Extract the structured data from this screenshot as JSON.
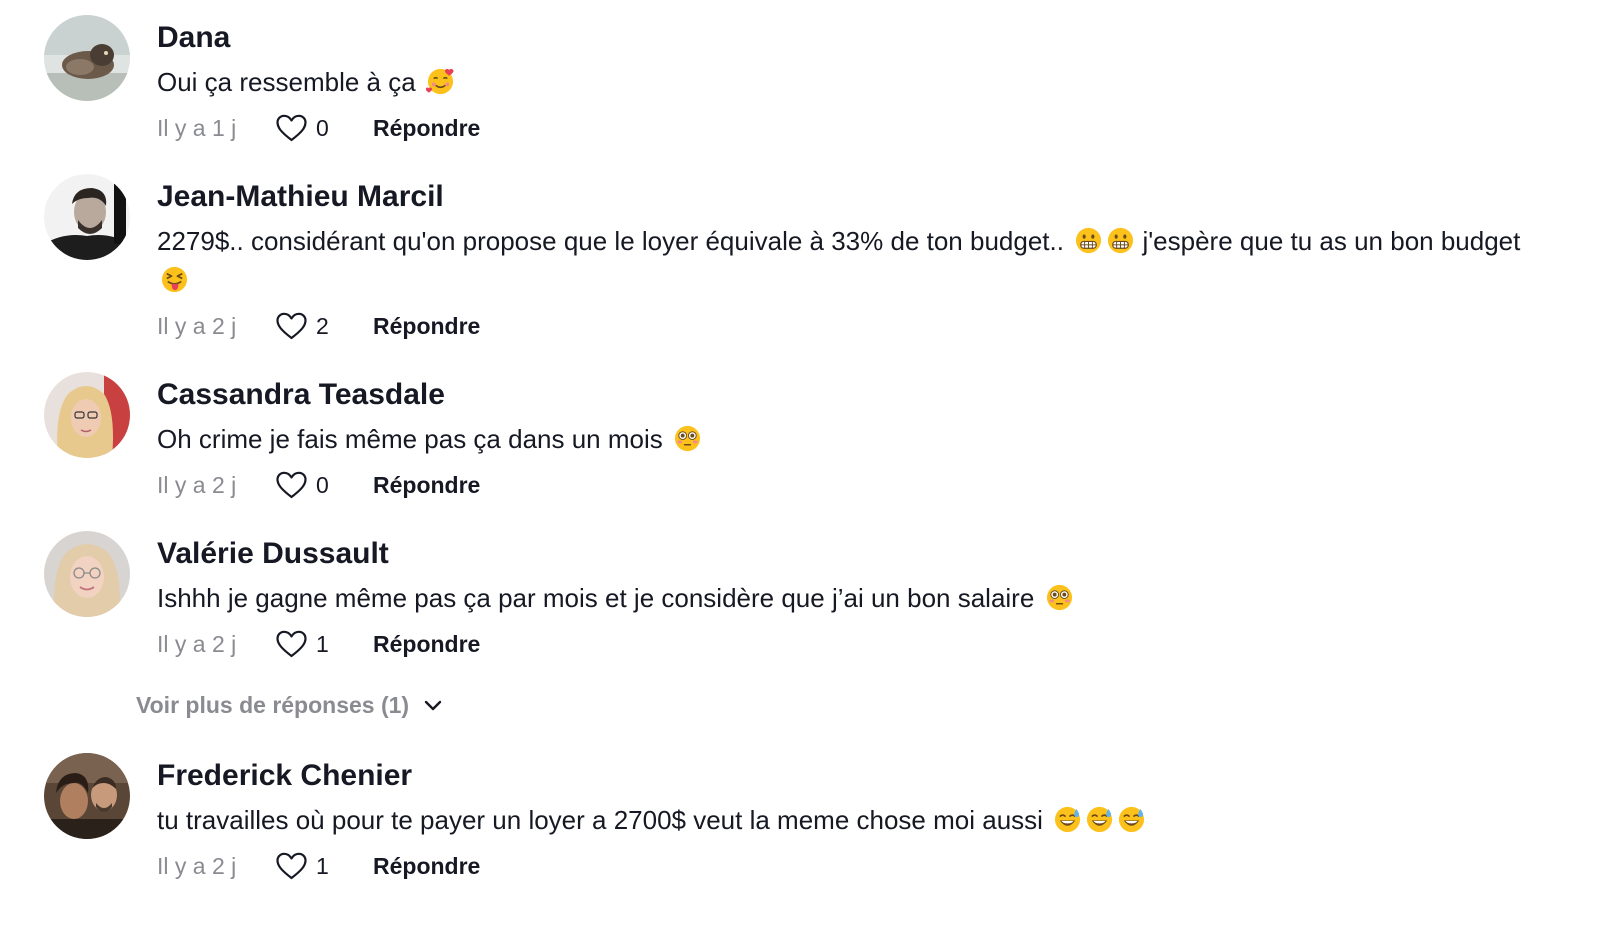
{
  "comments": [
    {
      "author": "Dana",
      "text": "Oui ça ressemble à ça",
      "emojis": [
        "smiling-face-with-hearts"
      ],
      "time": "Il y a 1 j",
      "likes": "0",
      "reply_label": "Répondre"
    },
    {
      "author": "Jean-Mathieu Marcil",
      "text": "2279$.. considérant qu'on propose que le loyer équivale à 33% de ton budget..",
      "text_emojis_mid": [
        "grimacing-face",
        "grimacing-face"
      ],
      "text_after": "j'espère que tu as un bon budget",
      "emojis": [
        "squinting-tongue-face"
      ],
      "time": "Il y a 2 j",
      "likes": "2",
      "reply_label": "Répondre"
    },
    {
      "author": "Cassandra Teasdale",
      "text": "Oh crime je fais même pas ça dans un mois",
      "emojis": [
        "flushed-face"
      ],
      "time": "Il y a 2 j",
      "likes": "0",
      "reply_label": "Répondre"
    },
    {
      "author": "Valérie Dussault",
      "text": "Ishhh je gagne même pas ça par mois et je considère que j’ai un bon salaire",
      "emojis": [
        "flushed-face"
      ],
      "time": "Il y a 2 j",
      "likes": "1",
      "reply_label": "Répondre"
    },
    {
      "author": "Frederick Chenier",
      "text": "tu travailles où pour te payer un loyer a 2700$ veut la meme chose moi aussi",
      "emojis": [
        "sweat-smile-face",
        "sweat-smile-face",
        "sweat-smile-face"
      ],
      "time": "Il y a 2 j",
      "likes": "1",
      "reply_label": "Répondre"
    }
  ],
  "more_replies_label": "Voir plus de réponses (1)",
  "icons": {
    "like": "heart-outline-icon",
    "expand": "chevron-down-icon"
  },
  "colors": {
    "text_primary": "#161823",
    "text_secondary": "#8a8b91",
    "emoji_yellow": "#fcc21b"
  }
}
